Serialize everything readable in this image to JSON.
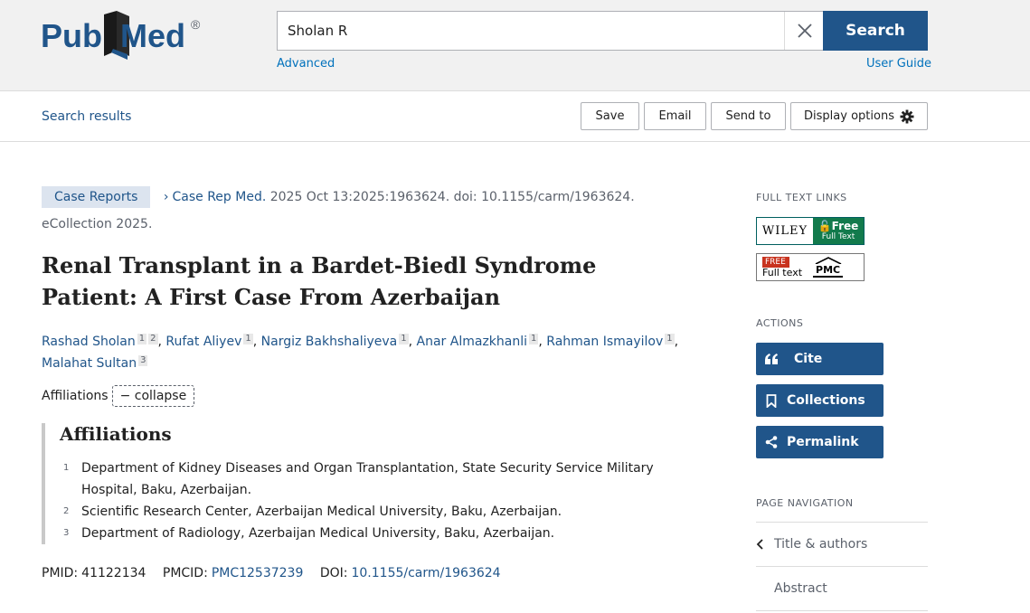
{
  "header": {
    "logo_pub": "Pub",
    "logo_med": "Med",
    "logo_reg": "®",
    "search_value": "Sholan R",
    "search_button": "Search",
    "advanced_link": "Advanced",
    "user_guide_link": "User Guide"
  },
  "actionbar": {
    "search_results": "Search results",
    "save": "Save",
    "email": "Email",
    "send_to": "Send to",
    "display_options": "Display options"
  },
  "article": {
    "type_badge": "Case Reports",
    "journal": "Case Rep Med.",
    "citation": " 2025 Oct 13:2025:1963624. doi: 10.1155/carm/1963624.",
    "ecollection": "eCollection 2025.",
    "title": "Renal Transplant in a Bardet-Biedl Syndrome Patient: A First Case From Azerbaijan",
    "authors": [
      {
        "name": "Rashad Sholan",
        "affs": [
          "1",
          "2"
        ]
      },
      {
        "name": "Rufat Aliyev",
        "affs": [
          "1"
        ]
      },
      {
        "name": "Nargiz Bakhshaliyeva",
        "affs": [
          "1"
        ]
      },
      {
        "name": "Anar Almazkhanli",
        "affs": [
          "1"
        ]
      },
      {
        "name": "Rahman Ismayilov",
        "affs": [
          "1"
        ]
      },
      {
        "name": "Malahat Sultan",
        "affs": [
          "3"
        ]
      }
    ],
    "affiliations_label": "Affiliations",
    "collapse_label": "collapse",
    "affiliations_heading": "Affiliations",
    "affiliations": [
      {
        "num": "1",
        "text": "Department of Kidney Diseases and Organ Transplantation, State Security Service Military Hospital, Baku, Azerbaijan."
      },
      {
        "num": "2",
        "text": "Scientific Research Center, Azerbaijan Medical University, Baku, Azerbaijan."
      },
      {
        "num": "3",
        "text": "Department of Radiology, Azerbaijan Medical University, Baku, Azerbaijan."
      }
    ],
    "pmid_label": "PMID:",
    "pmid": "41122134",
    "pmcid_label": "PMCID:",
    "pmcid": "PMC12537239",
    "doi_label": "DOI:",
    "doi": "10.1155/carm/1963624"
  },
  "sidebar": {
    "full_text_links_title": "FULL TEXT LINKS",
    "wiley_word": "WILEY",
    "wiley_free": "Free",
    "wiley_full_text": "Full Text",
    "pmc_free": "FREE",
    "pmc_full_text": "Full text",
    "pmc_logo": "PMC",
    "actions_title": "ACTIONS",
    "cite": "Cite",
    "collections": "Collections",
    "permalink": "Permalink",
    "page_nav_title": "PAGE NAVIGATION",
    "nav_items": [
      "Title & authors",
      "Abstract"
    ]
  },
  "colors": {
    "brand_blue": "#20558a",
    "link_blue": "#0071bc",
    "wiley_green": "#127a4c",
    "pmc_red": "#c8331f"
  }
}
